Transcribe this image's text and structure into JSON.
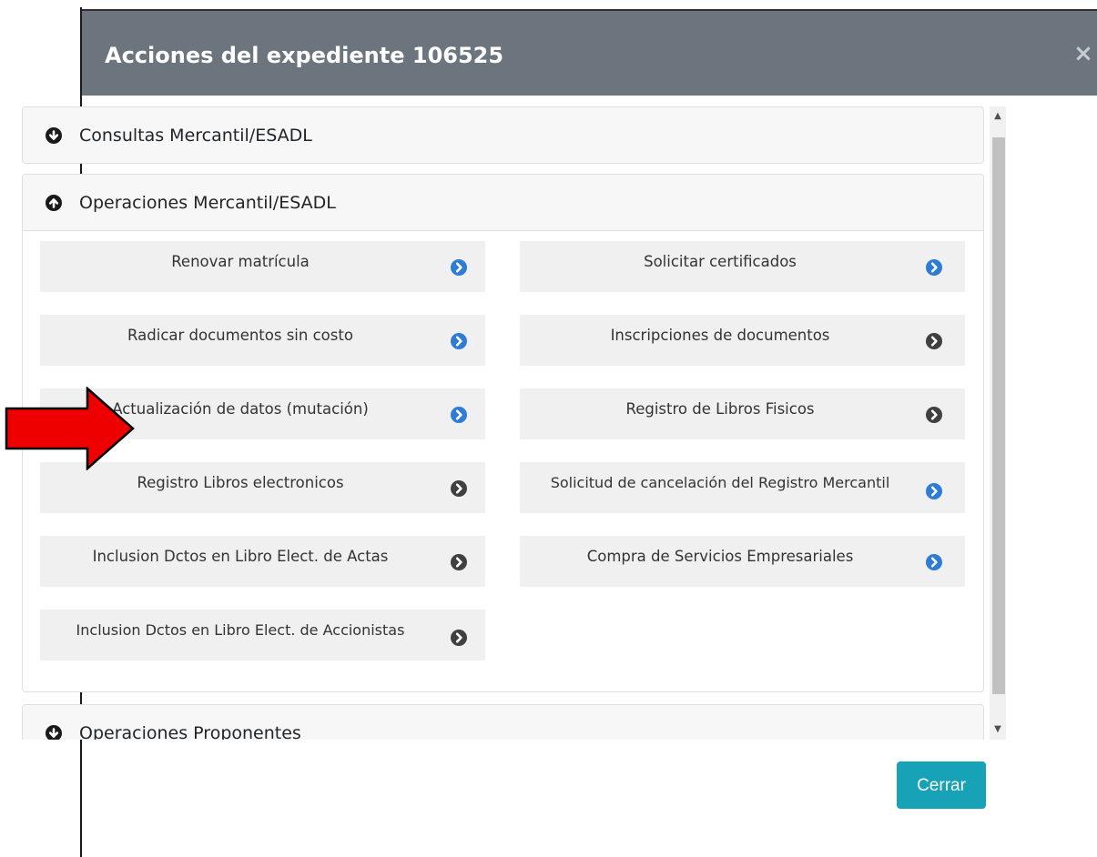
{
  "modal": {
    "title": "Acciones del expediente 106525",
    "close_symbol": "×"
  },
  "accordion": [
    {
      "title": "Consultas Mercantil/ESADL",
      "state": "collapsed",
      "icon": "arrow-circle-down-icon"
    },
    {
      "title": "Operaciones Mercantil/ESADL",
      "state": "expanded",
      "icon": "arrow-circle-up-icon"
    },
    {
      "title": "Operaciones Proponentes",
      "state": "collapsed",
      "icon": "arrow-circle-down-icon"
    }
  ],
  "actions": [
    {
      "label": "Renovar matrícula",
      "icon": "chevron-right-circle-icon",
      "color": "#2e7cd6"
    },
    {
      "label": "Solicitar certificados",
      "icon": "chevron-right-circle-icon",
      "color": "#2e7cd6"
    },
    {
      "label": "Radicar documentos sin costo",
      "icon": "chevron-right-circle-icon",
      "color": "#2e7cd6"
    },
    {
      "label": "Inscripciones de documentos",
      "icon": "chevron-right-circle-icon",
      "color": "#404040"
    },
    {
      "label": "Actualización de datos (mutación)",
      "icon": "chevron-right-circle-icon",
      "color": "#2e7cd6"
    },
    {
      "label": "Registro de Libros Fisicos",
      "icon": "chevron-right-circle-icon",
      "color": "#404040"
    },
    {
      "label": "Registro Libros electronicos",
      "icon": "chevron-right-circle-icon",
      "color": "#404040"
    },
    {
      "label": "Solicitud de cancelación del Registro Mercantil",
      "icon": "chevron-right-circle-icon",
      "color": "#2e7cd6"
    },
    {
      "label": "Inclusion Dctos en Libro Elect. de Actas",
      "icon": "chevron-right-circle-icon",
      "color": "#404040"
    },
    {
      "label": "Compra de Servicios Empresariales",
      "icon": "chevron-right-circle-icon",
      "color": "#2e7cd6"
    },
    {
      "label": "Inclusion Dctos en Libro Elect. de Accionistas",
      "icon": "chevron-right-circle-icon",
      "color": "#404040"
    }
  ],
  "footer": {
    "close_label": "Cerrar"
  },
  "colors": {
    "header_bg": "#6c757d",
    "primary_chevron": "#2e7cd6",
    "disabled_chevron": "#404040",
    "cerrar_bg": "#17a2b8",
    "annotation_arrow": "#ee0000"
  }
}
